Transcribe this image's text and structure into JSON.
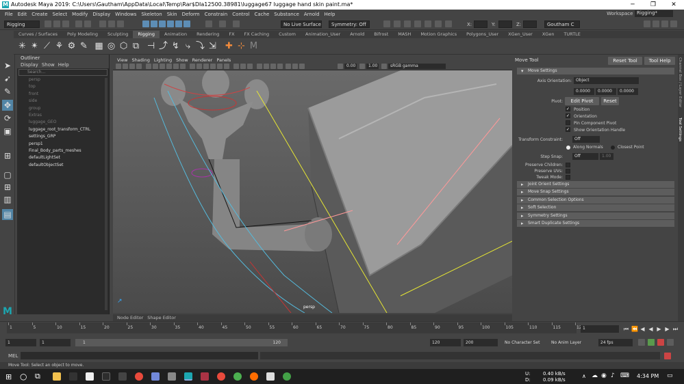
{
  "window": {
    "title": "Autodesk Maya 2019: C:\\Users\\Gautham\\AppData\\Local\\Temp\\Rar$DIa12500.38981\\luggage67 luggage hand skin paint.ma*"
  },
  "menubar": {
    "items": [
      "File",
      "Edit",
      "Create",
      "Select",
      "Modify",
      "Display",
      "Windows",
      "Skeleton",
      "Skin",
      "Deform",
      "Constrain",
      "Control",
      "Cache",
      "Substance",
      "Arnold",
      "Help"
    ],
    "workspace_label": "Workspace :",
    "workspace_value": "Rigging*"
  },
  "statusline": {
    "mode": "Rigging",
    "live_surface": "No Live Surface",
    "symmetry": "Symmetry: Off",
    "user": "Goutham C",
    "x_label": "X:",
    "y_label": "Y:",
    "z_label": "Z:"
  },
  "shelf": {
    "tabs": [
      "Curves / Surfaces",
      "Poly Modeling",
      "Sculpting",
      "Rigging",
      "Animation",
      "Rendering",
      "FX",
      "FX Caching",
      "Custom",
      "Animation_User",
      "Arnold",
      "Bifrost",
      "MASH",
      "Motion Graphics",
      "Polygons_User",
      "XGen_User",
      "XGen",
      "TURTLE"
    ],
    "active_tab": "Rigging"
  },
  "outliner": {
    "title": "Outliner",
    "menu": [
      "Display",
      "Show",
      "Help"
    ],
    "search_placeholder": "Search...",
    "items": [
      {
        "name": "persp",
        "dim": true
      },
      {
        "name": "top",
        "dim": true
      },
      {
        "name": "front",
        "dim": true
      },
      {
        "name": "side",
        "dim": true
      },
      {
        "name": "group",
        "dim": true
      },
      {
        "name": "Extras",
        "dim": true
      },
      {
        "name": "luggage_GEO",
        "dim": true
      },
      {
        "name": "luggage_root_transform_CTRL",
        "dim": false
      },
      {
        "name": "settings_GRP",
        "dim": false
      },
      {
        "name": "persp1",
        "dim": false
      },
      {
        "name": "Final_Body_parts_meshes",
        "dim": false
      },
      {
        "name": "defaultLightSet",
        "dim": false
      },
      {
        "name": "defaultObjectSet",
        "dim": false
      }
    ]
  },
  "viewport": {
    "menu": [
      "View",
      "Shading",
      "Lighting",
      "Show",
      "Renderer",
      "Panels"
    ],
    "exposure": "0.00",
    "gamma": "1.00",
    "color_space": "sRGB gamma",
    "camera_label": "persp",
    "bottom_tabs": [
      "Node Editor",
      "Shape Editor"
    ]
  },
  "tool_settings": {
    "title": "Move Tool",
    "reset_tool": "Reset Tool",
    "tool_help": "Tool Help",
    "section_move": "Move Settings",
    "axis_orientation_label": "Axis Orientation:",
    "axis_orientation_value": "Object",
    "axis_values": [
      "0.0000",
      "0.0000",
      "0.0000"
    ],
    "pivot_label": "Pivot:",
    "edit_pivot": "Edit Pivot",
    "reset": "Reset",
    "position": "Position",
    "orientation": "Orientation",
    "pin_component_pivot": "Pin Component Pivot",
    "show_orientation_handle": "Show Orientation Handle",
    "transform_constraint_label": "Transform Constraint:",
    "transform_constraint_value": "Off",
    "along_normals": "Along Normals",
    "closest_point": "Closest Point",
    "step_snap_label": "Step Snap:",
    "step_snap_value": "Off",
    "step_snap_num": "1.00",
    "preserve_children": "Preserve Children:",
    "preserve_uvs": "Preserve UVs:",
    "tweak_mode": "Tweak Mode:",
    "sections": [
      "Joint Orient Settings",
      "Move Snap Settings",
      "Common Selection Options",
      "Soft Selection",
      "Symmetry Settings",
      "Smart Duplicate Settings"
    ]
  },
  "side_strip": [
    "Channel Box / Layer Editor",
    "Tool Settings"
  ],
  "timeline": {
    "ticks": [
      "1",
      "5",
      "10",
      "15",
      "20",
      "25",
      "30",
      "35",
      "40",
      "45",
      "50",
      "55",
      "60",
      "65",
      "70",
      "75",
      "80",
      "85",
      "90",
      "95",
      "100",
      "105",
      "110",
      "115",
      "120"
    ],
    "current_frame": "1"
  },
  "range": {
    "start": "1",
    "playback_start": "1",
    "slider_start": "1",
    "slider_end": "120",
    "playback_end": "120",
    "end": "200",
    "character_set": "No Character Set",
    "anim_layer": "No Anim Layer",
    "fps": "24 fps"
  },
  "command_line": {
    "language": "MEL"
  },
  "help_line": "Move Tool: Select an object to move.",
  "taskbar": {
    "up_label": "U:",
    "down_label": "D:",
    "up_speed": "0.40 kB/s",
    "down_speed": "0.09 kB/s",
    "time": "4:34 PM"
  },
  "colors": {
    "accent": "#5285a6",
    "active_tab": "#545454"
  }
}
